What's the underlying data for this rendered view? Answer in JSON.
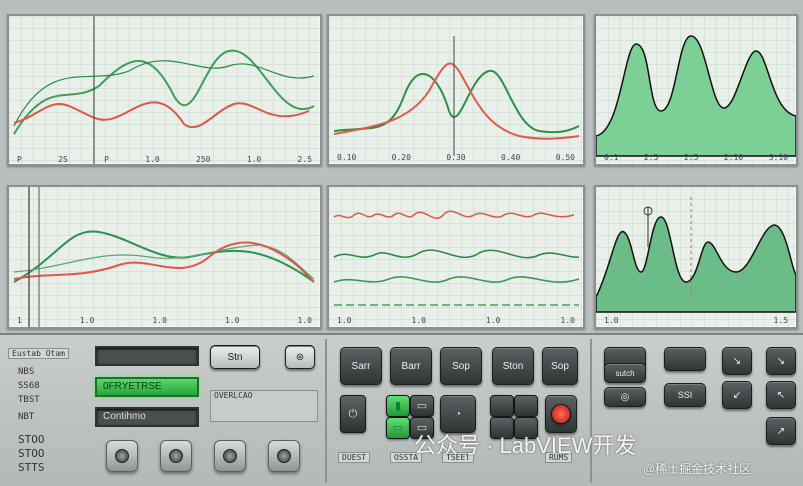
{
  "top_charts": [
    {
      "ticks": [
        "P",
        "2S",
        "P",
        "1.0",
        "250",
        "1.0",
        "2.5"
      ]
    },
    {
      "ticks": [
        "0.10",
        "0.20",
        "0.30",
        "0.40",
        "0.50"
      ]
    },
    {
      "ticks": [
        "0.1",
        "2.5",
        "2.5",
        "2.10",
        "3.10"
      ]
    }
  ],
  "bottom_charts": [
    {
      "ticks": [
        "1",
        "1.0",
        "1.0",
        "1.0",
        "1.0"
      ]
    },
    {
      "ticks": [
        "1.0",
        "1.0",
        "1.0",
        "1.0"
      ]
    },
    {
      "ticks": [
        "1.0",
        "1.5"
      ]
    }
  ],
  "controls": {
    "left_labels": [
      "Eustab Otam",
      "NBS",
      "SS68",
      "TBST",
      "NBT",
      "STOO",
      "STOO",
      "STTS"
    ],
    "status_field": "",
    "green_field": "0FRYETRSE",
    "condition_field": "Contihmo",
    "stn_label": "Stn",
    "overlay_label": "OVERLCAO",
    "buttons": {
      "start": "Sarr",
      "barr": "Barr",
      "sop": "Sop",
      "stop": "Ston",
      "sop2": "Sop"
    },
    "bottom_tags": [
      "DUEST",
      "OSSTA",
      "TSEET",
      "RUMS"
    ],
    "right_small": [
      "sutch",
      "SSI"
    ]
  },
  "watermark": {
    "line1": "公众号 · LabVIEW开发",
    "line2": "@稀土掘金技术社区"
  }
}
